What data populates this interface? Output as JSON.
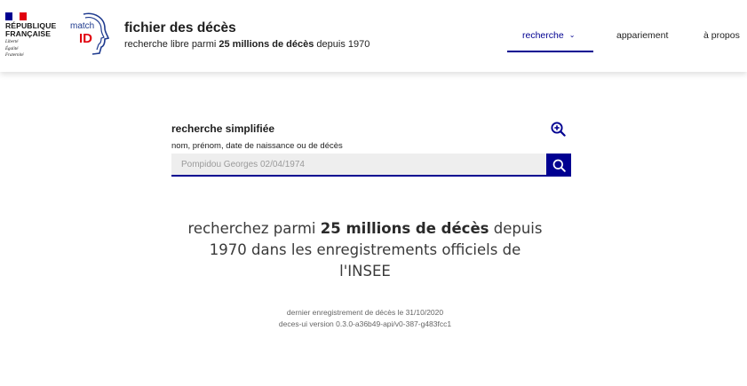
{
  "header": {
    "republic": {
      "name_line1": "RÉPUBLIQUE",
      "name_line2": "FRANÇAISE",
      "motto": [
        "Liberté",
        "Égalité",
        "Fraternité"
      ]
    },
    "logo": {
      "match": "match",
      "id": "ID"
    },
    "title": "fichier des décès",
    "subtitle": {
      "prefix": "recherche libre parmi ",
      "highlight": "25 millions de décès",
      "suffix": " depuis 1970"
    },
    "nav": {
      "search": "recherche",
      "matching": "appariement",
      "about": "à propos"
    }
  },
  "search": {
    "label": "recherche simplifiée",
    "hint": "nom, prénom, date de naissance ou de décès",
    "placeholder": "Pompidou Georges 02/04/1974",
    "value": ""
  },
  "tagline": {
    "prefix": "recherchez parmi ",
    "highlight": "25 millions de décès",
    "suffix": " depuis 1970 dans les enregistrements officiels de l'INSEE"
  },
  "footer": {
    "last_record": "dernier enregistrement de décès le 31/10/2020",
    "version": "deces-ui version 0.3.0-a36b49-api/v0-387-g483fcc1"
  },
  "colors": {
    "accent": "#000091",
    "brand_red": "#e1000f"
  }
}
